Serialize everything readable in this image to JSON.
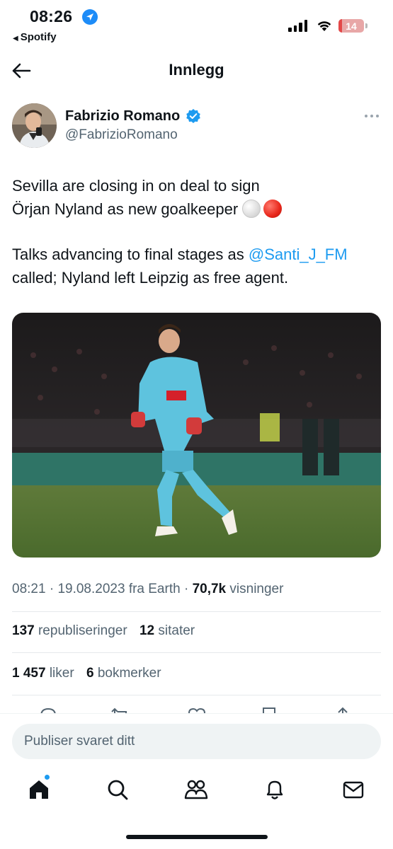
{
  "status_bar": {
    "time": "08:26",
    "back_app": "Spotify",
    "battery": "14",
    "battery_level": 0.14,
    "icons": [
      "location-arrow-icon",
      "cellular-signal-icon",
      "wifi-icon",
      "battery-icon"
    ]
  },
  "header": {
    "title": "Innlegg",
    "back_icon": "arrow-left-icon"
  },
  "tweet": {
    "author_name": "Fabrizio Romano",
    "author_handle": "@FabrizioRomano",
    "verified_color": "#1d9bf0",
    "text_line1": "Sevilla are closing in on deal to sign",
    "text_line2": "Örjan Nyland as new goalkeeper",
    "text_line3_pre": "Talks advancing to final stages as ",
    "mention": "@Santi_J_FM",
    "text_line4": "called; Nyland left Leipzig as free agent.",
    "emojis": [
      "white-circle-emoji",
      "red-circle-emoji"
    ],
    "media_alt_icon": "goalkeeper-photo",
    "time": "08:21",
    "date": "19.08.2023",
    "source": "fra Earth",
    "views_count": "70,7k",
    "views_label": "visninger",
    "reposts_count": "137",
    "reposts_label": "republiseringer",
    "quotes_count": "12",
    "quotes_label": "sitater",
    "likes_count": "1 457",
    "likes_label": "liker",
    "bookmarks_count": "6",
    "bookmarks_label": "bokmerker"
  },
  "actions": [
    "reply-icon",
    "repost-icon",
    "like-icon",
    "bookmark-icon",
    "share-icon"
  ],
  "reply": {
    "placeholder": "Publiser svaret ditt"
  },
  "tabs": [
    "home-icon",
    "search-icon",
    "communities-icon",
    "notifications-icon",
    "messages-icon"
  ],
  "colors": {
    "accent": "#1d9bf0",
    "text": "#0f1419",
    "secondary": "#536471"
  }
}
